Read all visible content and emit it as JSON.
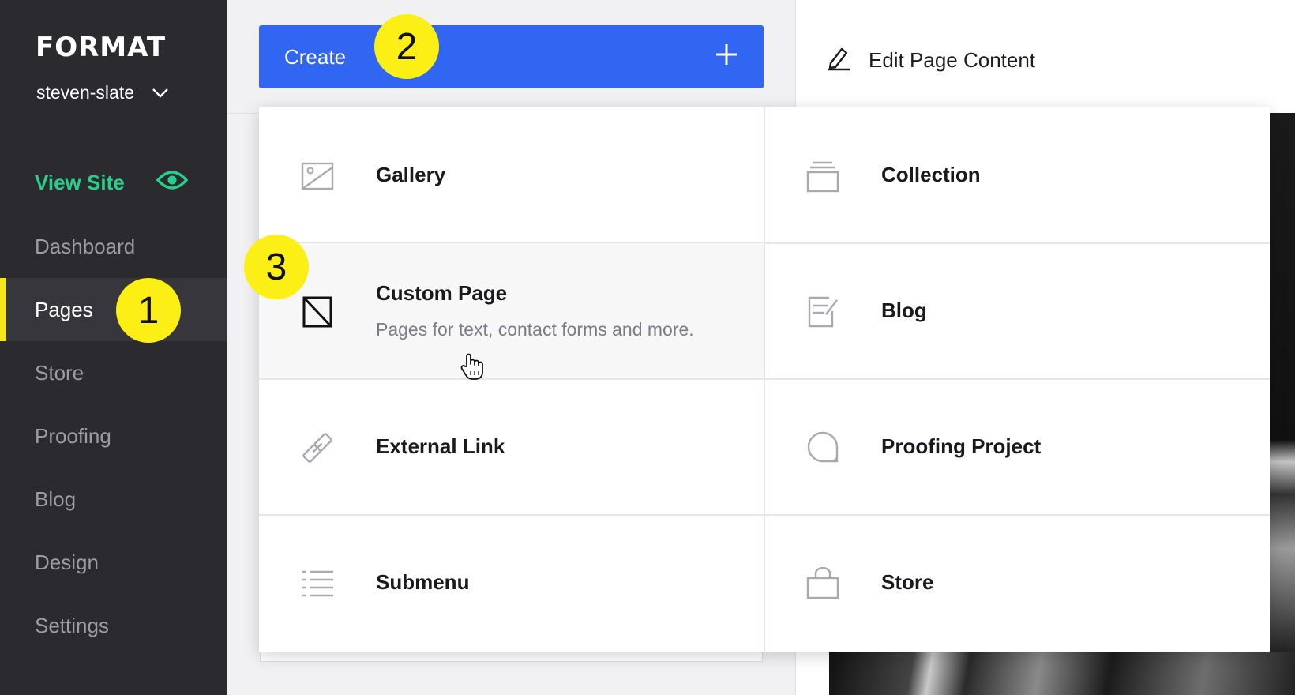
{
  "sidebar": {
    "logo": "FORMAT",
    "site_name": "steven-slate",
    "view_site_label": "View Site",
    "items": [
      {
        "label": "Dashboard",
        "active": false
      },
      {
        "label": "Pages",
        "active": true
      },
      {
        "label": "Store",
        "active": false
      },
      {
        "label": "Proofing",
        "active": false
      },
      {
        "label": "Blog",
        "active": false
      },
      {
        "label": "Design",
        "active": false
      },
      {
        "label": "Settings",
        "active": false
      }
    ]
  },
  "toolbar": {
    "create_label": "Create",
    "edit_content_label": "Edit Page Content"
  },
  "create_menu": {
    "options": [
      {
        "label": "Gallery",
        "icon": "gallery-icon"
      },
      {
        "label": "Collection",
        "icon": "collection-icon"
      },
      {
        "label": "Custom Page",
        "icon": "custom-page-icon",
        "description": "Pages for text, contact forms and more."
      },
      {
        "label": "Blog",
        "icon": "blog-icon"
      },
      {
        "label": "External Link",
        "icon": "link-icon"
      },
      {
        "label": "Proofing Project",
        "icon": "proofing-icon"
      },
      {
        "label": "Submenu",
        "icon": "list-icon"
      },
      {
        "label": "Store",
        "icon": "bag-icon"
      }
    ]
  },
  "callouts": [
    "1",
    "2",
    "3"
  ],
  "colors": {
    "sidebar_bg": "#2a2a2f",
    "accent_blue": "#3166f2",
    "view_site_green": "#26d08a",
    "active_indicator": "#f5e61b",
    "callout_yellow": "#fbef16"
  }
}
